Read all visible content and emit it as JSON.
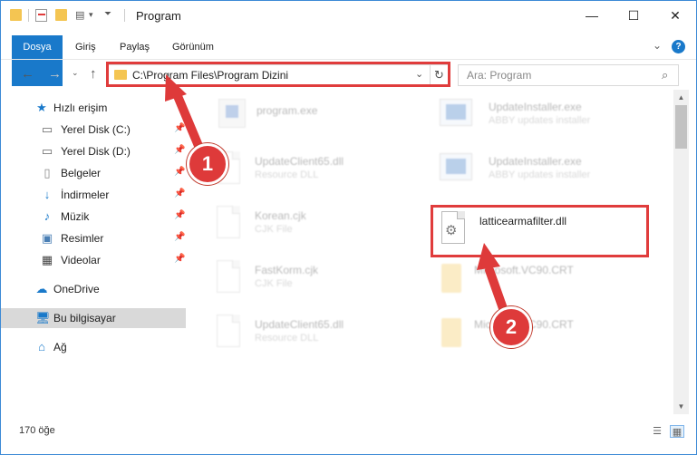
{
  "window": {
    "title": "Program",
    "controls": {
      "minimize": "—",
      "maximize": "☐",
      "close": "✕"
    }
  },
  "ribbon": {
    "tabs": [
      "Dosya",
      "Giriş",
      "Paylaş",
      "Görünüm"
    ],
    "help": "?"
  },
  "address": {
    "path": "C:\\Program Files\\Program Dizini"
  },
  "search": {
    "placeholder": "Ara: Program"
  },
  "sidebar": {
    "items": [
      {
        "label": "Hızlı erişim",
        "icon": "star-icon"
      },
      {
        "label": "Yerel Disk (C:)",
        "icon": "drive-icon",
        "pinned": true
      },
      {
        "label": "Yerel Disk (D:)",
        "icon": "drive-icon",
        "pinned": true
      },
      {
        "label": "Belgeler",
        "icon": "document-icon",
        "pinned": true
      },
      {
        "label": "İndirmeler",
        "icon": "download-icon",
        "pinned": true
      },
      {
        "label": "Müzik",
        "icon": "music-icon",
        "pinned": true
      },
      {
        "label": "Resimler",
        "icon": "picture-icon",
        "pinned": true
      },
      {
        "label": "Videolar",
        "icon": "video-icon",
        "pinned": true
      },
      {
        "label": "OneDrive",
        "icon": "cloud-icon"
      },
      {
        "label": "Bu bilgisayar",
        "icon": "computer-icon",
        "selected": true
      },
      {
        "label": "Ağ",
        "icon": "network-icon"
      }
    ]
  },
  "files": [
    {
      "name": "program.exe",
      "sub": "",
      "type": "exe"
    },
    {
      "name": "UpdateInstaller.exe",
      "sub": "ABBY updates installer",
      "type": "installer"
    },
    {
      "name": "UpdateClient65.dll",
      "sub": "Resource DLL",
      "type": "doc"
    },
    {
      "name": "UpdateInstaller.exe",
      "sub": "ABBY updates installer",
      "type": "installer"
    },
    {
      "name": "Korean.cjk",
      "sub": "CJK File",
      "type": "doc"
    },
    {
      "name": "latticearmafilter.dll",
      "sub": "",
      "type": "dll"
    },
    {
      "name": "FastKorm.cjk",
      "sub": "CJK File",
      "type": "doc"
    },
    {
      "name": "Microsoft.VC90.CRT",
      "sub": "",
      "type": "folder"
    },
    {
      "name": "UpdateClient65.dll",
      "sub": "Resource DLL",
      "type": "doc"
    },
    {
      "name": "Microsoft.VC90.CRT",
      "sub": "",
      "type": "folder"
    }
  ],
  "status": {
    "count": "170 öğe"
  },
  "annotations": {
    "badge1": "1",
    "badge2": "2"
  },
  "colors": {
    "accent": "#1979ca",
    "highlight": "#e03c3c",
    "folder": "#f4c552"
  }
}
